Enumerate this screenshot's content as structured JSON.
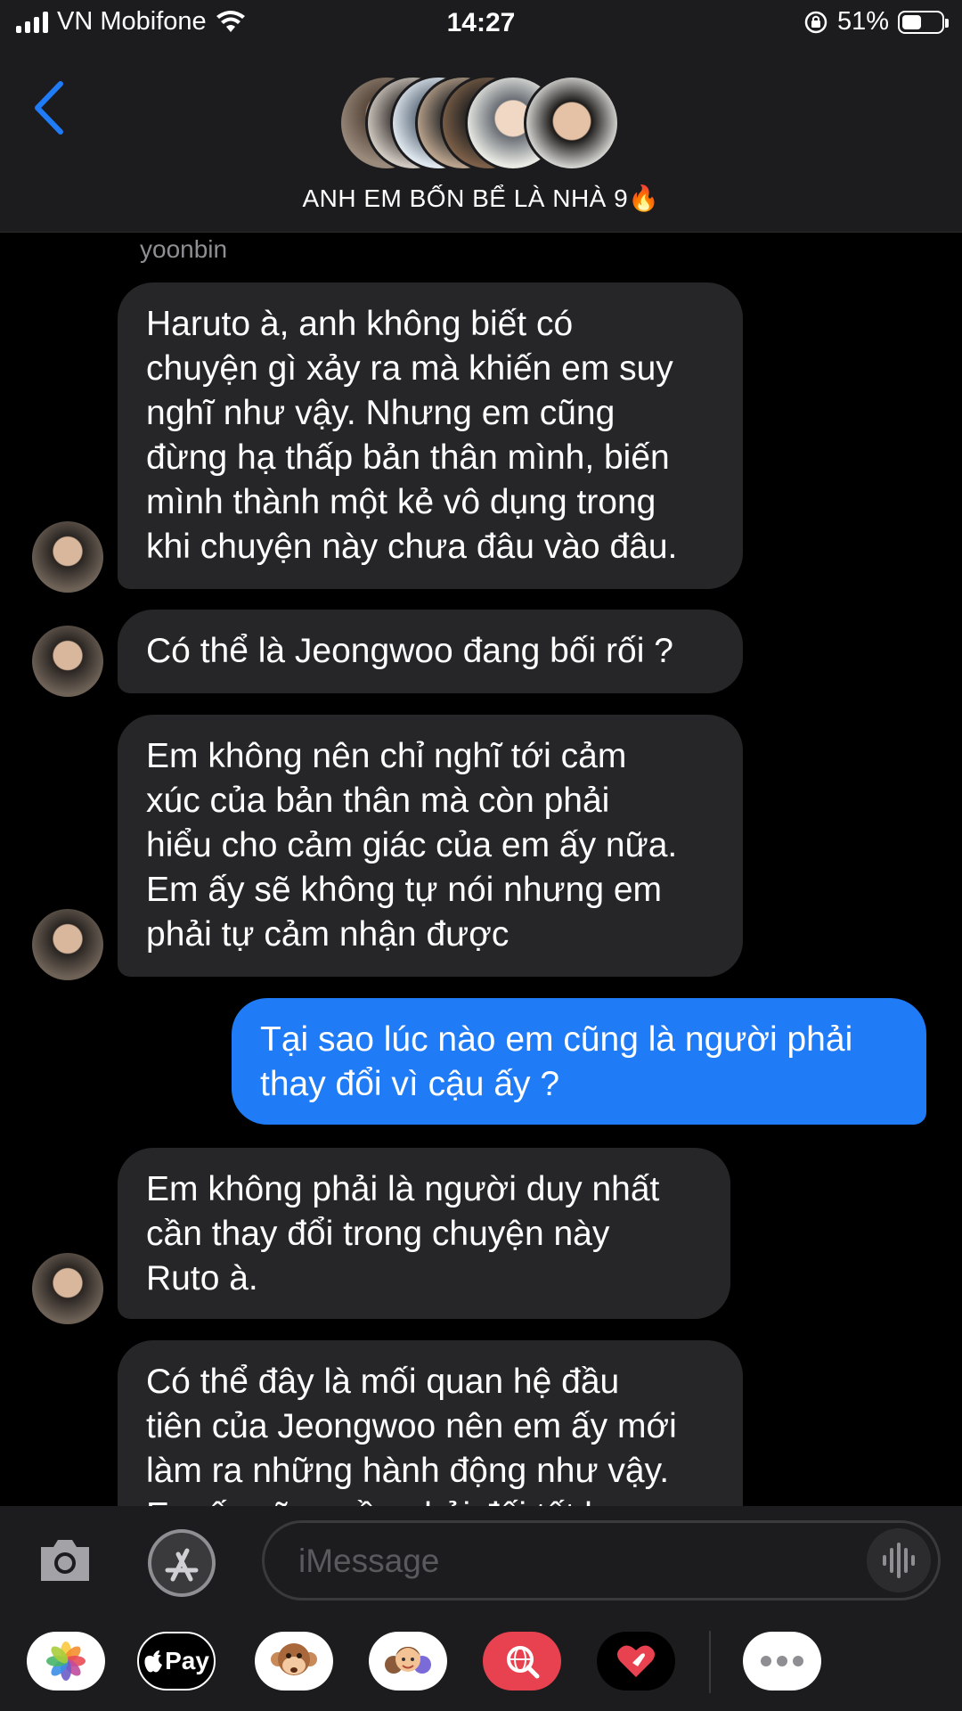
{
  "status_bar": {
    "carrier": "VN Mobifone",
    "time": "14:27",
    "battery_percent": "51%",
    "battery_level": 0.51
  },
  "header": {
    "group_name": "ANH EM BỐN BỂ LÀ NHÀ 9🔥"
  },
  "chat": {
    "sender_name": "yoonbin",
    "messages": [
      {
        "direction": "in",
        "text": "Haruto à, anh không biết có\nchuyện gì xảy ra mà khiến em suy\nnghĩ như vậy. Nhưng em cũng\nđừng hạ thấp bản thân mình, biến\nmình thành một kẻ vô dụng trong\nkhi chuyện này chưa đâu vào đâu."
      },
      {
        "direction": "in",
        "text": "Có thể là Jeongwoo đang bối rối ?"
      },
      {
        "direction": "in",
        "text": "Em không nên chỉ nghĩ tới cảm\nxúc của bản thân mà còn phải\nhiểu cho cảm giác của em ấy nữa.\nEm ấy sẽ không tự nói nhưng em\nphải tự cảm nhận được"
      },
      {
        "direction": "out",
        "text": "Tại sao lúc nào em cũng là người phải\nthay đổi vì cậu ấy ?"
      },
      {
        "direction": "in",
        "text": "Em không phải là người duy nhất\ncần thay đổi trong chuyện này\nRuto à."
      },
      {
        "direction": "in",
        "text": "Có thể đây là mối quan hệ đầu\ntiên của Jeongwoo nên em ấy mới\nlàm ra những hành động như vậy.\nEm ấy cũng cần phải đối tốt hơn"
      }
    ]
  },
  "input_bar": {
    "placeholder": "iMessage"
  },
  "app_drawer": {
    "apps": [
      "photos-icon",
      "apple-pay-icon",
      "animoji-icon",
      "memoji-icon",
      "web-search-icon",
      "digital-touch-icon",
      "more-icon"
    ],
    "apple_pay_label": "Pay"
  },
  "colors": {
    "incoming_bubble": "#262628",
    "outgoing_bubble": "#1f7bf6",
    "accent": "#1f7bf6"
  }
}
